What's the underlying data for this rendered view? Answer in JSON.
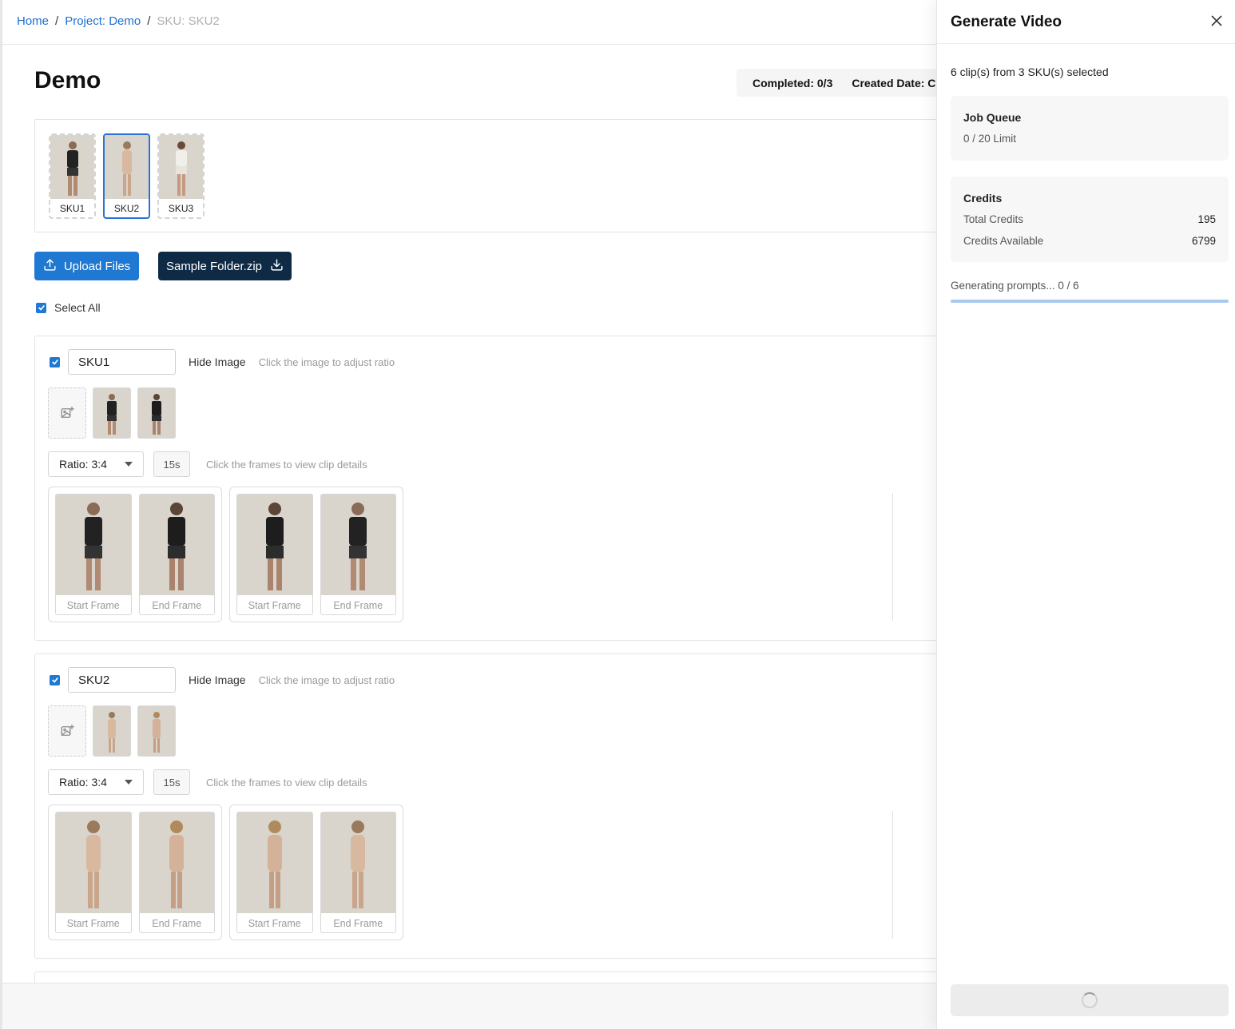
{
  "breadcrumb": {
    "home": "Home",
    "sep": "/",
    "project": "Project: Demo",
    "current": "SKU: SKU2"
  },
  "page": {
    "title": "Demo",
    "completed": "Completed: 0/3",
    "created": "Created Date: C"
  },
  "sku_strip": [
    {
      "label": "SKU1",
      "active": false
    },
    {
      "label": "SKU2",
      "active": true
    },
    {
      "label": "SKU3",
      "active": false
    }
  ],
  "actions": {
    "upload_label": "Upload Files",
    "sample_label": "Sample Folder.zip"
  },
  "select_all": {
    "label": "Select All",
    "checked": true
  },
  "sku_cards": [
    {
      "name": "SKU1",
      "checked": true,
      "hide_image": "Hide Image",
      "image_hint": "Click the image to adjust ratio",
      "ratio": "Ratio: 3:4",
      "duration": "15s",
      "frames_hint": "Click the frames to view clip details",
      "frames": [
        "Start Frame",
        "End Frame",
        "Start Frame",
        "End Frame"
      ]
    },
    {
      "name": "SKU2",
      "checked": true,
      "hide_image": "Hide Image",
      "image_hint": "Click the image to adjust ratio",
      "ratio": "Ratio: 3:4",
      "duration": "15s",
      "frames_hint": "Click the frames to view clip details",
      "frames": [
        "Start Frame",
        "End Frame",
        "Start Frame",
        "End Frame"
      ]
    }
  ],
  "drawer": {
    "title": "Generate Video",
    "summary": "6 clip(s) from 3 SKU(s) selected",
    "job_queue": {
      "title": "Job Queue",
      "value": "0 / 20 Limit"
    },
    "credits": {
      "title": "Credits",
      "total_label": "Total Credits",
      "total_value": "195",
      "available_label": "Credits Available",
      "available_value": "6799"
    },
    "progress_text": "Generating prompts... 0 / 6",
    "progress": 0
  },
  "colors": {
    "accent": "#1f78d1",
    "dark_button": "#0e2a45",
    "link": "#1e6fd1",
    "panel_bg": "#f7f7f7"
  },
  "icons": {
    "upload": "upload-icon",
    "download": "download-icon",
    "close": "close-icon",
    "add_image": "add-image-icon",
    "caret": "chevron-down-icon",
    "check": "check-icon",
    "spinner": "spinner-icon"
  }
}
